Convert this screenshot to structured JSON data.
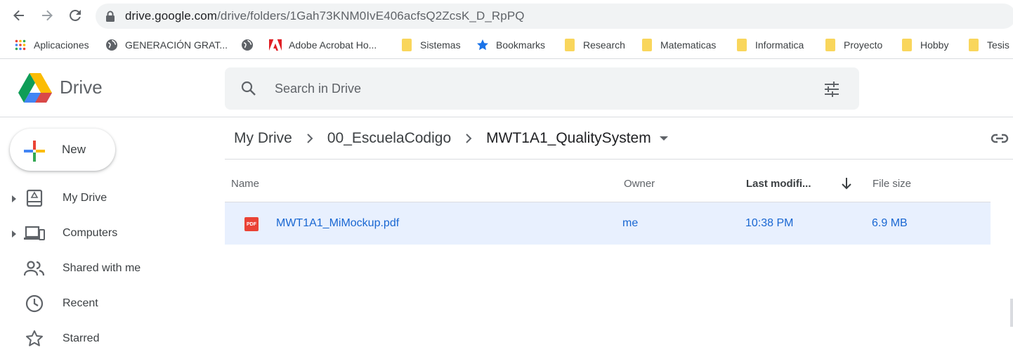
{
  "browser": {
    "url_host": "drive.google.com",
    "url_path": "/drive/folders/1Gah73KNM0IvE406acfsQ2ZcsK_D_RpPQ",
    "back_icon": "arrow-left-icon",
    "forward_icon": "arrow-right-icon",
    "reload_icon": "reload-icon",
    "lock_icon": "lock-icon"
  },
  "bookmarks": [
    {
      "label": "Aplicaciones",
      "icon": "apps-grid-icon"
    },
    {
      "label": "GENERACIÓN GRAT...",
      "icon": "globe-icon"
    },
    {
      "label": "",
      "icon": "globe-icon"
    },
    {
      "label": "Adobe Acrobat Ho...",
      "icon": "adobe-icon"
    },
    {
      "label": "Sistemas",
      "icon": "folder-icon"
    },
    {
      "label": "Bookmarks",
      "icon": "star-icon"
    },
    {
      "label": "Research",
      "icon": "folder-icon"
    },
    {
      "label": "Matematicas",
      "icon": "folder-icon"
    },
    {
      "label": "Informatica",
      "icon": "folder-icon"
    },
    {
      "label": "Proyecto",
      "icon": "folder-icon"
    },
    {
      "label": "Hobby",
      "icon": "folder-icon"
    },
    {
      "label": "Tesis",
      "icon": "folder-icon"
    }
  ],
  "header": {
    "app_name": "Drive",
    "search_placeholder": "Search in Drive"
  },
  "sidebar": {
    "new_label": "New",
    "items": [
      {
        "label": "My Drive",
        "icon": "my-drive-icon",
        "expandable": true
      },
      {
        "label": "Computers",
        "icon": "computers-icon",
        "expandable": true
      },
      {
        "label": "Shared with me",
        "icon": "shared-people-icon",
        "expandable": false
      },
      {
        "label": "Recent",
        "icon": "clock-icon",
        "expandable": false
      },
      {
        "label": "Starred",
        "icon": "star-outline-icon",
        "expandable": false
      }
    ]
  },
  "breadcrumb": [
    "My Drive",
    "00_EscuelaCodigo",
    "MWT1A1_QualitySystem"
  ],
  "table": {
    "headers": {
      "name": "Name",
      "owner": "Owner",
      "modified": "Last modifi...",
      "size": "File size"
    },
    "rows": [
      {
        "name": "MWT1A1_MiMockup.pdf",
        "owner": "me",
        "modified": "10:38 PM",
        "size": "6.9 MB",
        "type_icon": "pdf-icon",
        "type_text": "PDF"
      }
    ]
  },
  "colors": {
    "selected_row": "#e8f0fe",
    "selected_text": "#1967d2",
    "search_bg": "#f1f3f4"
  }
}
